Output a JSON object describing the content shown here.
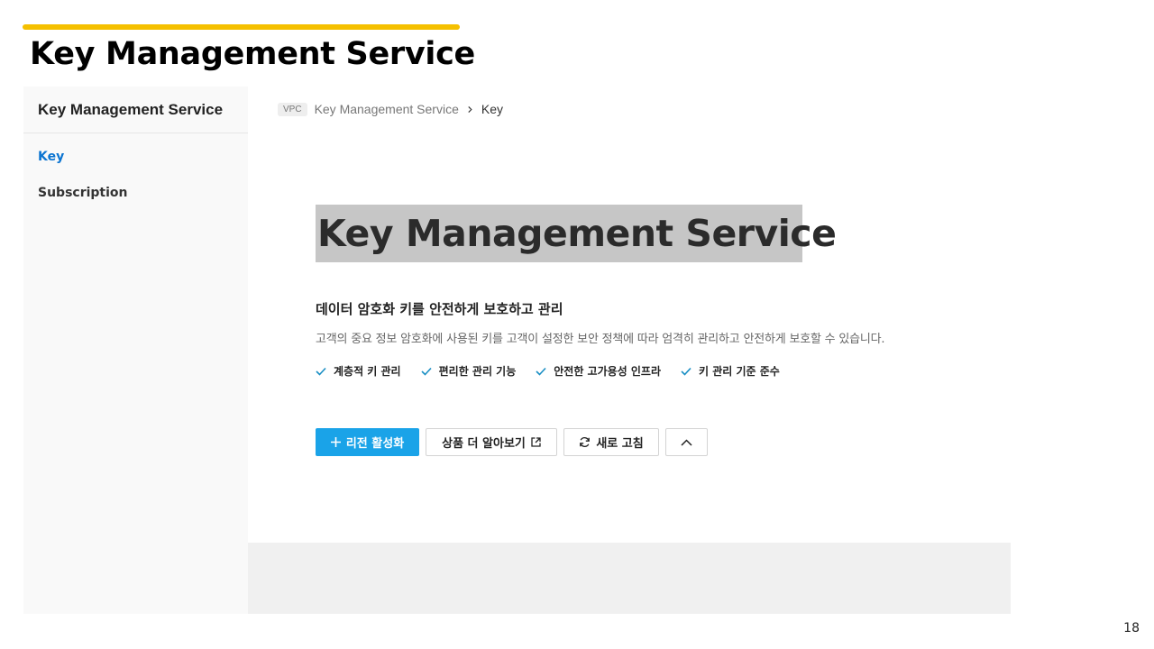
{
  "slide": {
    "title": "Key Management Service",
    "page_number": "18"
  },
  "colors": {
    "accent_bar": "#f5c000",
    "primary": "#1aa3e8",
    "active_link": "#0b74d1",
    "check": "#1a8fc4"
  },
  "sidebar": {
    "title": "Key Management Service",
    "items": [
      {
        "label": "Key",
        "active": true
      },
      {
        "label": "Subscription",
        "active": false
      }
    ]
  },
  "breadcrumb": {
    "badge": "VPC",
    "service": "Key Management Service",
    "current": "Key"
  },
  "hero": {
    "title": "Key Management Service",
    "subtitle": "데이터 암호화 키를 안전하게 보호하고 관리",
    "description": "고객의 중요 정보 암호화에 사용된 키를 고객이 설정한 보안 정책에 따라 엄격히 관리하고 안전하게 보호할 수 있습니다.",
    "features": [
      "계층적 키 관리",
      "편리한 관리 기능",
      "안전한 고가용성 인프라",
      "키 관리 기준 준수"
    ]
  },
  "actions": {
    "activate_label": "리전 활성화",
    "learn_more_label": "상품 더 알아보기",
    "refresh_label": "새로 고침",
    "icons": {
      "activate": "plus-icon",
      "learn_more": "external-link-icon",
      "refresh": "refresh-icon",
      "collapse": "chevron-up-icon"
    }
  }
}
